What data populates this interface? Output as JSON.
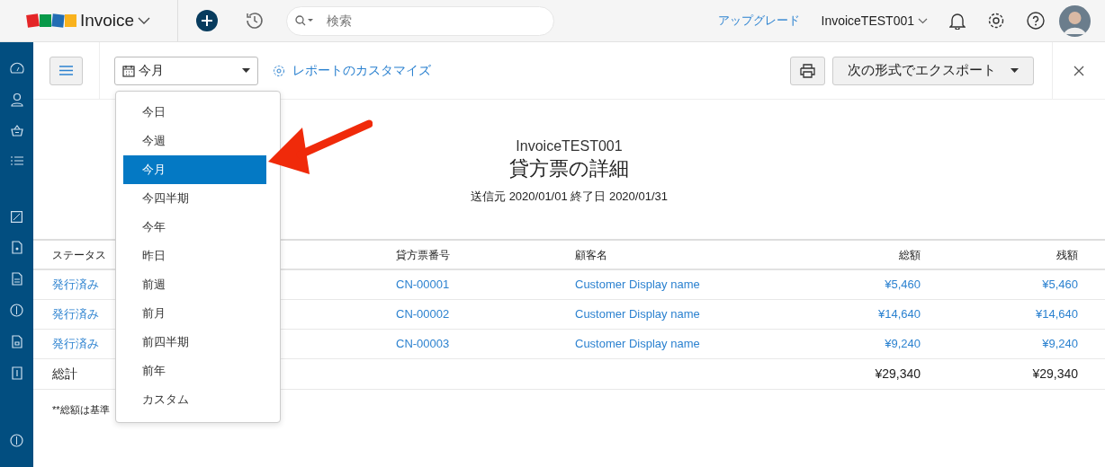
{
  "topbar": {
    "app_name": "Invoice",
    "search": {
      "placeholder": "検索"
    },
    "upgrade": "アップグレード",
    "org": "InvoiceTEST001"
  },
  "toolbar": {
    "period": "今月",
    "customize": "レポートのカスタマイズ",
    "export": "次の形式でエクスポート"
  },
  "period_menu": [
    {
      "label": "今日",
      "selected": false
    },
    {
      "label": "今週",
      "selected": false
    },
    {
      "label": "今月",
      "selected": true
    },
    {
      "label": "今四半期",
      "selected": false
    },
    {
      "label": "今年",
      "selected": false
    },
    {
      "label": "昨日",
      "selected": false
    },
    {
      "label": "前週",
      "selected": false
    },
    {
      "label": "前月",
      "selected": false
    },
    {
      "label": "前四半期",
      "selected": false
    },
    {
      "label": "前年",
      "selected": false
    },
    {
      "label": "カスタム",
      "selected": false
    }
  ],
  "report": {
    "org": "InvoiceTEST001",
    "title": "貸方票の詳細",
    "range": "送信元 2020/01/01 終了日 2020/01/31"
  },
  "table": {
    "columns": [
      "ステータス",
      "貸方票番号",
      "顧客名",
      "総額",
      "残額"
    ],
    "rows": [
      [
        "発行済み",
        "CN-00001",
        "Customer Display name",
        "¥5,460",
        "¥5,460"
      ],
      [
        "発行済み",
        "CN-00002",
        "Customer Display name",
        "¥14,640",
        "¥14,640"
      ],
      [
        "発行済み",
        "CN-00003",
        "Customer Display name",
        "¥9,240",
        "¥9,240"
      ]
    ],
    "total": {
      "label": "総計",
      "amount": "¥29,340",
      "balance": "¥29,340"
    }
  },
  "footnote": "**総額は基準"
}
